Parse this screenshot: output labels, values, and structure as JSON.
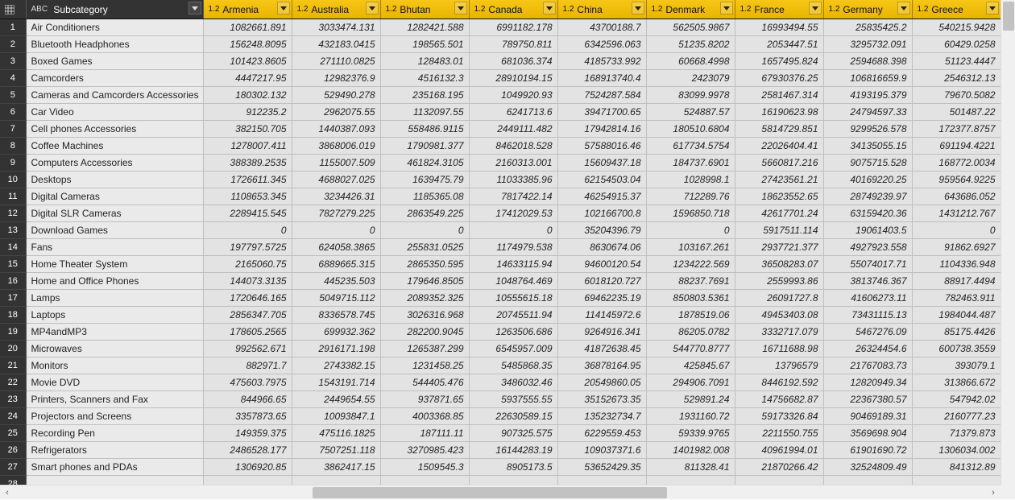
{
  "columns": {
    "rownum": "",
    "subcategory_type": "ABC",
    "subcategory_label": "Subcategory",
    "num_type": "1.2",
    "countries": [
      "Armenia",
      "Australia",
      "Bhutan",
      "Canada",
      "China",
      "Denmark",
      "France",
      "Germany",
      "Greece"
    ],
    "stub_type": "1.2"
  },
  "rows": [
    {
      "n": 1,
      "sub": "Air Conditioners",
      "v": [
        "1082661.891",
        "3033474.131",
        "1282421.588",
        "6991182.178",
        "43700188.7",
        "562505.9867",
        "16993494.55",
        "25835425.2",
        "540215.9428"
      ]
    },
    {
      "n": 2,
      "sub": "Bluetooth Headphones",
      "v": [
        "156248.8095",
        "432183.0415",
        "198565.501",
        "789750.811",
        "6342596.063",
        "51235.8202",
        "2053447.51",
        "3295732.091",
        "60429.0258"
      ]
    },
    {
      "n": 3,
      "sub": "Boxed Games",
      "v": [
        "101423.8605",
        "271110.0825",
        "128483.01",
        "681036.374",
        "4185733.992",
        "60668.4998",
        "1657495.824",
        "2594688.398",
        "51123.4447"
      ]
    },
    {
      "n": 4,
      "sub": "Camcorders",
      "v": [
        "4447217.95",
        "12982376.9",
        "4516132.3",
        "28910194.15",
        "168913740.4",
        "2423079",
        "67930376.25",
        "106816659.9",
        "2546312.13"
      ]
    },
    {
      "n": 5,
      "sub": "Cameras and Camcorders Accessories",
      "v": [
        "180302.132",
        "529490.278",
        "235168.195",
        "1049920.93",
        "7524287.584",
        "83099.9978",
        "2581467.314",
        "4193195.379",
        "79670.5082"
      ]
    },
    {
      "n": 6,
      "sub": "Car Video",
      "v": [
        "912235.2",
        "2962075.55",
        "1132097.55",
        "6241713.6",
        "39471700.65",
        "524887.57",
        "16190623.98",
        "24794597.33",
        "501487.22"
      ]
    },
    {
      "n": 7,
      "sub": "Cell phones Accessories",
      "v": [
        "382150.705",
        "1440387.093",
        "558486.9115",
        "2449111.482",
        "17942814.16",
        "180510.6804",
        "5814729.851",
        "9299526.578",
        "172377.8757"
      ]
    },
    {
      "n": 8,
      "sub": "Coffee Machines",
      "v": [
        "1278007.411",
        "3868006.019",
        "1790981.377",
        "8462018.528",
        "57588016.46",
        "617734.5754",
        "22026404.41",
        "34135055.15",
        "691194.4221"
      ]
    },
    {
      "n": 9,
      "sub": "Computers Accessories",
      "v": [
        "388389.2535",
        "1155007.509",
        "461824.3105",
        "2160313.001",
        "15609437.18",
        "184737.6901",
        "5660817.216",
        "9075715.528",
        "168772.0034"
      ]
    },
    {
      "n": 10,
      "sub": "Desktops",
      "v": [
        "1726611.345",
        "4688027.025",
        "1639475.79",
        "11033385.96",
        "62154503.04",
        "1028998.1",
        "27423561.21",
        "40169220.25",
        "959564.9225"
      ]
    },
    {
      "n": 11,
      "sub": "Digital Cameras",
      "v": [
        "1108653.345",
        "3234426.31",
        "1185365.08",
        "7817422.14",
        "46254915.37",
        "712289.76",
        "18623552.65",
        "28749239.97",
        "643686.052"
      ]
    },
    {
      "n": 12,
      "sub": "Digital SLR Cameras",
      "v": [
        "2289415.545",
        "7827279.225",
        "2863549.225",
        "17412029.53",
        "102166700.8",
        "1596850.718",
        "42617701.24",
        "63159420.36",
        "1431212.767"
      ]
    },
    {
      "n": 13,
      "sub": "Download Games",
      "v": [
        "0",
        "0",
        "0",
        "0",
        "35204396.79",
        "0",
        "5917511.114",
        "19061403.5",
        "0"
      ]
    },
    {
      "n": 14,
      "sub": "Fans",
      "v": [
        "197797.5725",
        "624058.3865",
        "255831.0525",
        "1174979.538",
        "8630674.06",
        "103167.261",
        "2937721.377",
        "4927923.558",
        "91862.6927"
      ]
    },
    {
      "n": 15,
      "sub": "Home Theater System",
      "v": [
        "2165060.75",
        "6889665.315",
        "2865350.595",
        "14633115.94",
        "94600120.54",
        "1234222.569",
        "36508283.07",
        "55074017.71",
        "1104336.948"
      ]
    },
    {
      "n": 16,
      "sub": "Home and Office Phones",
      "v": [
        "144073.3135",
        "445235.503",
        "179646.8505",
        "1048764.469",
        "6018120.727",
        "88237.7691",
        "2559993.86",
        "3813746.367",
        "88917.4494"
      ]
    },
    {
      "n": 17,
      "sub": "Lamps",
      "v": [
        "1720646.165",
        "5049715.112",
        "2089352.325",
        "10555615.18",
        "69462235.19",
        "850803.5361",
        "26091727.8",
        "41606273.11",
        "782463.911"
      ]
    },
    {
      "n": 18,
      "sub": "Laptops",
      "v": [
        "2856347.705",
        "8336578.745",
        "3026316.968",
        "20745511.94",
        "114145972.6",
        "1878519.06",
        "49453403.08",
        "73431115.13",
        "1984044.487"
      ]
    },
    {
      "n": 19,
      "sub": "MP4andMP3",
      "v": [
        "178605.2565",
        "699932.362",
        "282200.9045",
        "1263506.686",
        "9264916.341",
        "86205.0782",
        "3332717.079",
        "5467276.09",
        "85175.4426"
      ]
    },
    {
      "n": 20,
      "sub": "Microwaves",
      "v": [
        "992562.671",
        "2916171.198",
        "1265387.299",
        "6545957.009",
        "41872638.45",
        "544770.8777",
        "16711688.98",
        "26324454.6",
        "600738.3559"
      ]
    },
    {
      "n": 21,
      "sub": "Monitors",
      "v": [
        "882971.7",
        "2743382.15",
        "1231458.25",
        "5485868.35",
        "36878164.95",
        "425845.67",
        "13796579",
        "21767083.73",
        "393079.1"
      ]
    },
    {
      "n": 22,
      "sub": "Movie DVD",
      "v": [
        "475603.7975",
        "1543191.714",
        "544405.476",
        "3486032.46",
        "20549860.05",
        "294906.7091",
        "8446192.592",
        "12820949.34",
        "313866.672"
      ]
    },
    {
      "n": 23,
      "sub": "Printers, Scanners and Fax",
      "v": [
        "844966.65",
        "2449654.55",
        "937871.65",
        "5937555.55",
        "35152673.35",
        "529891.24",
        "14756682.87",
        "22367380.57",
        "547942.02"
      ]
    },
    {
      "n": 24,
      "sub": "Projectors and Screens",
      "v": [
        "3357873.65",
        "10093847.1",
        "4003368.85",
        "22630589.15",
        "135232734.7",
        "1931160.72",
        "59173326.84",
        "90469189.31",
        "2160777.23"
      ]
    },
    {
      "n": 25,
      "sub": "Recording Pen",
      "v": [
        "149359.375",
        "475116.1825",
        "187111.11",
        "907325.575",
        "6229559.453",
        "59339.9765",
        "2211550.755",
        "3569698.904",
        "71379.873"
      ]
    },
    {
      "n": 26,
      "sub": "Refrigerators",
      "v": [
        "2486528.177",
        "7507251.118",
        "3270985.423",
        "16144283.19",
        "109037371.6",
        "1401982.008",
        "40961994.01",
        "61901690.72",
        "1306034.002"
      ]
    },
    {
      "n": 27,
      "sub": "Smart phones and PDAs",
      "v": [
        "1306920.85",
        "3862417.15",
        "1509545.3",
        "8905173.5",
        "53652429.35",
        "811328.41",
        "21870266.42",
        "32524809.49",
        "841312.89"
      ]
    },
    {
      "n": 28,
      "sub": "",
      "v": [
        "",
        "",
        "",
        "",
        "",
        "",
        "",
        "",
        ""
      ]
    }
  ]
}
